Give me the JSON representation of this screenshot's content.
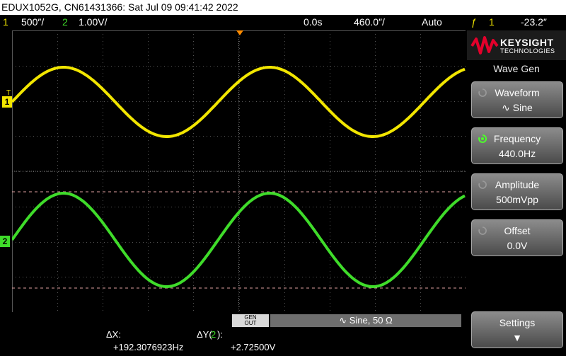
{
  "title_bar": {
    "text": "EDUX1052G, CN61431366: Sat Jul 09 09:41:42 2022"
  },
  "status": {
    "ch1_num": "1",
    "ch1_scale": "500″/",
    "ch2_num": "2",
    "ch2_scale": "1.00V/",
    "time_pos": "0.0s",
    "time_scale": "460.0″/",
    "trigger_mode": "Auto",
    "trigger_icon": "ƒ",
    "trigger_ch": "1",
    "trigger_level": "-23.2″"
  },
  "colors": {
    "ch1": "#f2e600",
    "ch2": "#3fdc2a",
    "grid": "#555555",
    "cursor": "#e0a0a0"
  },
  "markers": {
    "ch1": "1",
    "ch2": "2",
    "trig": "T"
  },
  "logo": {
    "brand": "KEYSIGHT",
    "sub": "TECHNOLOGIES"
  },
  "menu": {
    "title": "Wave Gen",
    "softkeys": [
      {
        "label": "Waveform",
        "value": "∿  Sine"
      },
      {
        "label": "Frequency",
        "value": "440.0Hz"
      },
      {
        "label": "Amplitude",
        "value": "500mVpp"
      },
      {
        "label": "Offset",
        "value": "0.0V"
      },
      {
        "label": "Settings",
        "value": "▼"
      }
    ]
  },
  "bottom": {
    "genout_line1": "GEN",
    "genout_line2": "OUT",
    "sine_info": "∿  Sine, 50 Ω"
  },
  "measure": {
    "dx_label": "ΔX:",
    "dx_value": "+192.3076923Hz",
    "dy_label": "ΔY(",
    "dy_ch": "2",
    "dy_close": "):",
    "dy_value": "+2.72500V"
  },
  "waveforms": {
    "cycles_visible": 2.2
  }
}
